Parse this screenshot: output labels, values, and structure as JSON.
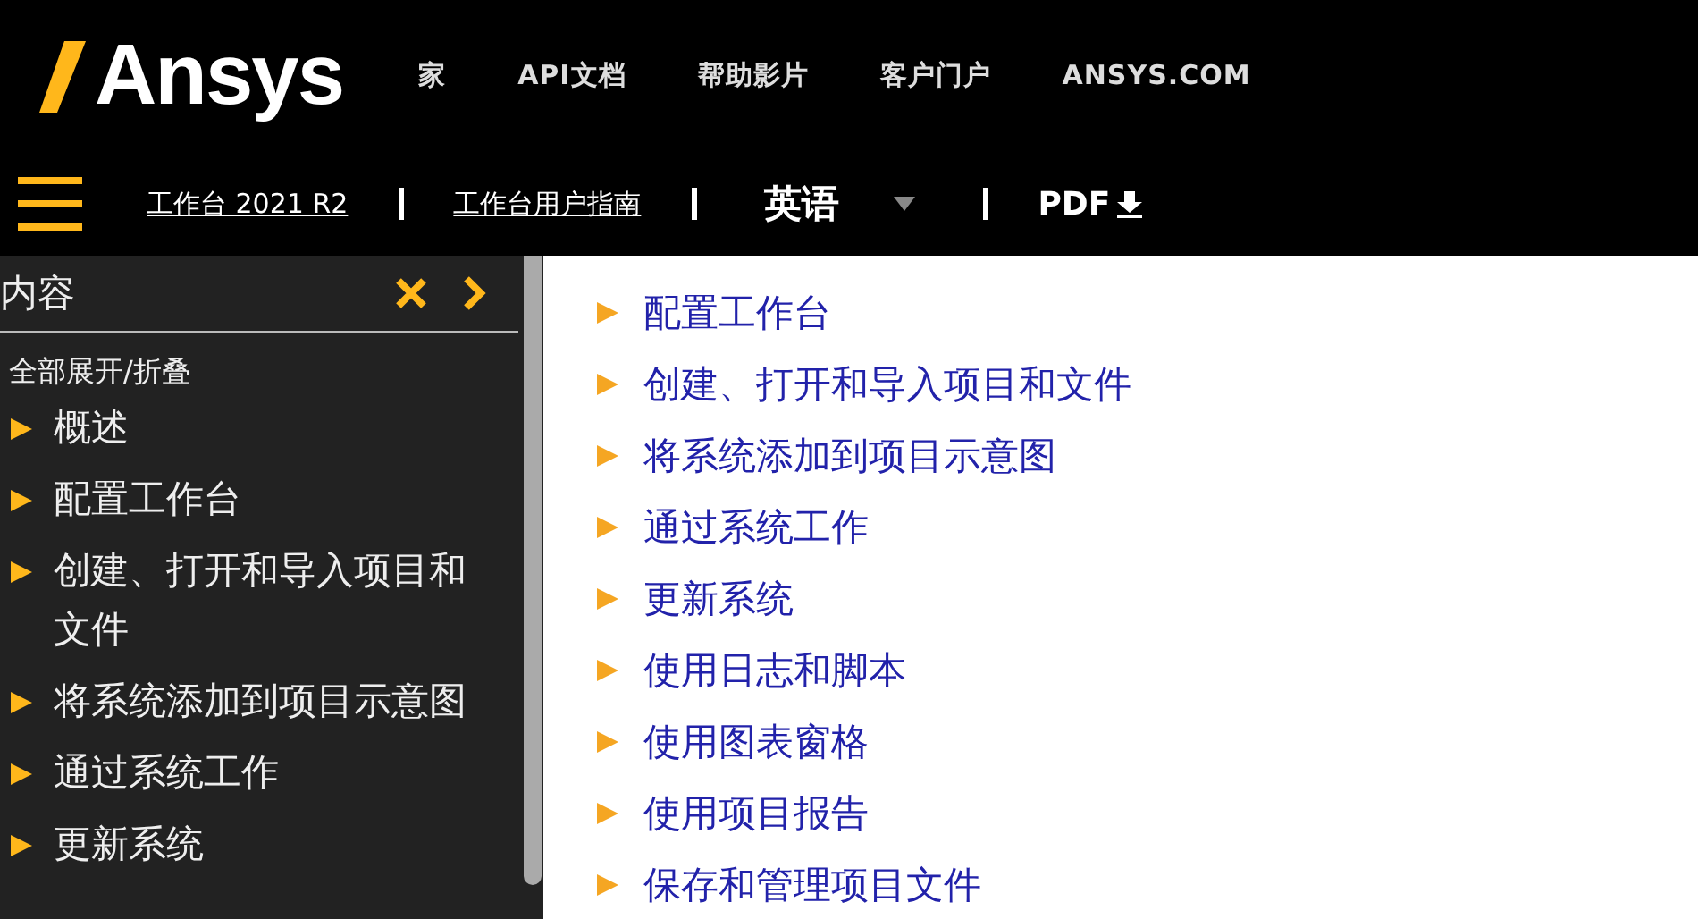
{
  "header": {
    "logo": "Ansys",
    "nav": [
      "家",
      "API文档",
      "帮助影片",
      "客户门户",
      "ANSYS.COM"
    ]
  },
  "breadcrumb": {
    "links": [
      "工作台 2021 R2",
      "工作台用户指南"
    ],
    "language": "英语",
    "pdf": "PDF"
  },
  "sidebar": {
    "title": "内容",
    "expand_collapse": "全部展开/折叠",
    "items": [
      {
        "label": "概述"
      },
      {
        "label": "配置工作台"
      },
      {
        "label": "创建、打开和导入项目和文件"
      },
      {
        "label": "将系统添加到项目示意图"
      },
      {
        "label": "通过系统工作"
      },
      {
        "label": "更新系统"
      }
    ]
  },
  "main": {
    "items": [
      "配置工作台",
      "创建、打开和导入项目和文件",
      "将系统添加到项目示意图",
      "通过系统工作",
      "更新系统",
      "使用日志和脚本",
      "使用图表窗格",
      "使用项目报告",
      "保存和管理项目文件"
    ]
  }
}
